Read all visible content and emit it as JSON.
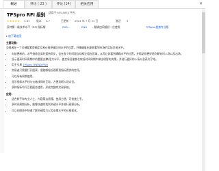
{
  "tabs": [
    {
      "label": "概述"
    },
    {
      "label": "评论 ( 23 )"
    },
    {
      "label": "评论 (14)"
    },
    {
      "label": "相关应用"
    }
  ],
  "app": {
    "title": "TPSpro RFI 级别",
    "subtitle": "适用于 MT4/MT5 平台",
    "rating_value": "4.83",
    "version_label": "版本",
    "version": "4.7",
    "updated_label": "已更新",
    "updated": "2024 年 7 月 31 日",
    "activations_label": "激活",
    "activations": "5"
  },
  "info": {
    "category_label": "反转第一级技术水平（RFI 指标版",
    "category_link": "RUS...",
    "lang_label": "ENG",
    "author_note": "- 翻译由同组织一位使用",
    "author_link": "TPSpro 趋势专业版"
  },
  "content": {
    "link_top": "▸ 加下载连接",
    "heading_main": "主要功能:",
    "intro": "交易者在一个关键要素是确定交易价格突破区间水平的位置，并精确量化能够看到市场的实际交易水平。",
    "items": [
      {
        "text": "向前更新的，水平指标会实时保持同步，会在各个时间段自动标注相应区域，从而让你看到精确水平的位置，并帮助你更好地判断何时入场以及出场。"
      },
      {
        "text": "显示更高时间周期中的重要支撑/阻力水平，使交易员能够在较低时间周期中做出明智的决策，并进行更好的入场以及获利了结。"
      },
      {
        "text": "用于交易",
        "link": "TPSpro TREND PRO"
      },
      {
        "text": "交易者只需要打开图表，便能够轻松观察到指标提供的信号。"
      },
      {
        "text": "可在所有周期使用。"
      },
      {
        "text": "显示指标水平线与价格线间的互动，方便判断入场点位。"
      },
      {
        "text": "多种指标均可互相配合使用，形成完整的交易系统。"
      }
    ],
    "heading_apps": "应用:",
    "app_items": [
      "适合新手和专业人士，内容简洁易懂，使用方便，可快速上手。",
      "多时间周期分析，能够快速的找到关键水平并进行观察分析。",
      "可以在图表中快速了解关键阻力以及支撑水平的价格变化。"
    ]
  },
  "colors": {
    "accent": "#1a5bd6",
    "star": "#f3b400"
  }
}
